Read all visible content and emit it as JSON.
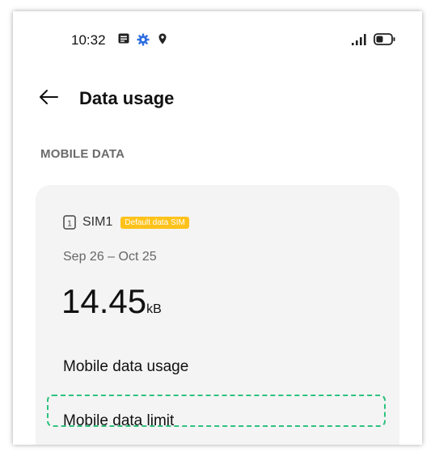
{
  "status_bar": {
    "time": "10:32",
    "icons": [
      "notification-icon",
      "gear-icon",
      "location-icon",
      "signal-icon",
      "battery-icon"
    ]
  },
  "app_bar": {
    "back_icon": "arrow-left-icon",
    "title": "Data usage"
  },
  "section": {
    "header": "MOBILE DATA"
  },
  "card": {
    "sim_label": "SIM1",
    "sim_badge": "Default data SIM",
    "date_range": "Sep 26 – Oct 25",
    "usage_number": "14.45",
    "usage_unit": "kB",
    "items": [
      {
        "label": "Mobile data usage"
      },
      {
        "label": "Mobile data limit"
      }
    ]
  },
  "colors": {
    "badge": "#ffc21a",
    "card_bg": "#f4f4f4",
    "highlight": "#2ec27e"
  }
}
